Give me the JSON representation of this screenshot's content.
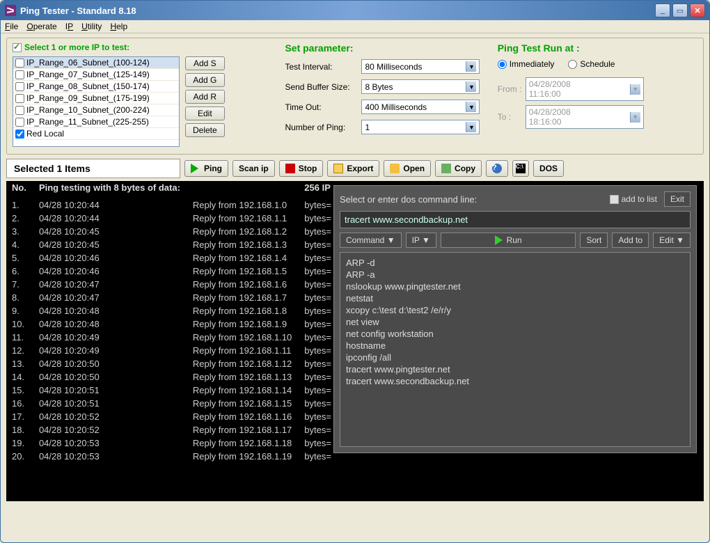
{
  "window": {
    "title": "Ping Tester - Standard  8.18"
  },
  "menu": {
    "file": "File",
    "operate": "Operate",
    "ip": "IP",
    "utility": "Utility",
    "help": "Help"
  },
  "section1": {
    "title": "Select 1 or more IP to test:",
    "items": [
      {
        "label": "IP_Range_06_Subnet_(100-124)",
        "checked": false,
        "sel": true
      },
      {
        "label": "IP_Range_07_Subnet_(125-149)",
        "checked": false
      },
      {
        "label": "IP_Range_08_Subnet_(150-174)",
        "checked": false
      },
      {
        "label": "IP_Range_09_Subnet_(175-199)",
        "checked": false
      },
      {
        "label": "IP_Range_10_Subnet_(200-224)",
        "checked": false
      },
      {
        "label": "IP_Range_11_Subnet_(225-255)",
        "checked": false
      },
      {
        "label": "Red Local",
        "checked": true
      }
    ],
    "btns": {
      "adds": "Add S",
      "addg": "Add G",
      "addr": "Add R",
      "edit": "Edit",
      "delete": "Delete"
    }
  },
  "section2": {
    "title": "Set parameter:",
    "interval_l": "Test Interval:",
    "interval_v": "80  Milliseconds",
    "buffer_l": "Send Buffer Size:",
    "buffer_v": "8  Bytes",
    "timeout_l": "Time Out:",
    "timeout_v": "400  Milliseconds",
    "numping_l": "Number of Ping:",
    "numping_v": "1"
  },
  "section3": {
    "title": "Ping Test Run at :",
    "opt_imm": "Immediately",
    "opt_sched": "Schedule",
    "from_l": "From :",
    "from_v": "04/28/2008 11:16:00",
    "to_l": "To :",
    "to_v": "04/28/2008 18:16:00"
  },
  "toolbar": {
    "selected": "Selected 1 Items",
    "ping": "Ping",
    "scan": "Scan ip",
    "stop": "Stop",
    "export": "Export",
    "open": "Open",
    "copy": "Copy",
    "dos": "DOS"
  },
  "console": {
    "h_no": "No.",
    "h_main": "Ping testing with 8 bytes of data:",
    "h_ip": "256  IP",
    "h_bytes": "bytes=",
    "rows": [
      {
        "n": "1.",
        "t": "04/28 10:20:44",
        "r": "Reply from 192.168.1.0"
      },
      {
        "n": "2.",
        "t": "04/28 10:20:44",
        "r": "Reply from 192.168.1.1"
      },
      {
        "n": "3.",
        "t": "04/28 10:20:45",
        "r": "Reply from 192.168.1.2"
      },
      {
        "n": "4.",
        "t": "04/28 10:20:45",
        "r": "Reply from 192.168.1.3"
      },
      {
        "n": "5.",
        "t": "04/28 10:20:46",
        "r": "Reply from 192.168.1.4"
      },
      {
        "n": "6.",
        "t": "04/28 10:20:46",
        "r": "Reply from 192.168.1.5"
      },
      {
        "n": "7.",
        "t": "04/28 10:20:47",
        "r": "Reply from 192.168.1.6"
      },
      {
        "n": "8.",
        "t": "04/28 10:20:47",
        "r": "Reply from 192.168.1.7"
      },
      {
        "n": "9.",
        "t": "04/28 10:20:48",
        "r": "Reply from 192.168.1.8"
      },
      {
        "n": "10.",
        "t": "04/28 10:20:48",
        "r": "Reply from 192.168.1.9"
      },
      {
        "n": "11.",
        "t": "04/28 10:20:49",
        "r": "Reply from 192.168.1.10"
      },
      {
        "n": "12.",
        "t": "04/28 10:20:49",
        "r": "Reply from 192.168.1.11"
      },
      {
        "n": "13.",
        "t": "04/28 10:20:50",
        "r": "Reply from 192.168.1.12"
      },
      {
        "n": "14.",
        "t": "04/28 10:20:50",
        "r": "Reply from 192.168.1.13"
      },
      {
        "n": "15.",
        "t": "04/28 10:20:51",
        "r": "Reply from 192.168.1.14"
      },
      {
        "n": "16.",
        "t": "04/28 10:20:51",
        "r": "Reply from 192.168.1.15"
      },
      {
        "n": "17.",
        "t": "04/28 10:20:52",
        "r": "Reply from 192.168.1.16"
      },
      {
        "n": "18.",
        "t": "04/28 10:20:52",
        "r": "Reply from 192.168.1.17"
      },
      {
        "n": "19.",
        "t": "04/28 10:20:53",
        "r": "Reply from 192.168.1.18"
      },
      {
        "n": "20.",
        "t": "04/28 10:20:53",
        "r": "Reply from 192.168.1.19"
      }
    ]
  },
  "dos": {
    "prompt": "Select or enter dos command line:",
    "addlist": "add to list",
    "exit": "Exit",
    "input": "tracert www.secondbackup.net",
    "cmd": "Command",
    "ip": "IP",
    "run": "Run",
    "sort": "Sort",
    "addto": "Add to",
    "edit": "Edit",
    "list": [
      "ARP -d",
      "ARP -a",
      "nslookup www.pingtester.net",
      "netstat",
      "xcopy c:\\test d:\\test2 /e/r/y",
      "net view",
      "net config workstation",
      "hostname",
      "ipconfig /all",
      "tracert www.pingtester.net",
      "tracert www.secondbackup.net"
    ]
  }
}
